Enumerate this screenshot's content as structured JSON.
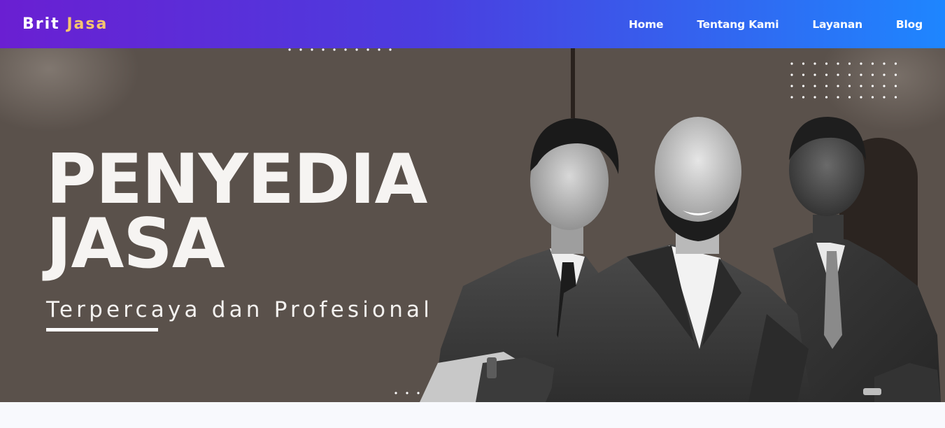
{
  "navbar": {
    "brand": {
      "primary": "Brit",
      "accent": "Jasa"
    },
    "links": [
      {
        "label": "Home"
      },
      {
        "label": "Tentang Kami"
      },
      {
        "label": "Layanan"
      },
      {
        "label": "Blog"
      }
    ],
    "colors": {
      "gradient_start": "#6a1fd2",
      "gradient_end": "#1e86ff",
      "brand_accent": "#f6c56e"
    }
  },
  "hero": {
    "title_line1": "PENYEDIA",
    "title_line2": "JASA",
    "subtitle": "Terpercaya dan Profesional",
    "background_color": "#5a514b",
    "image_description_icon": "three-businessmen-photo"
  }
}
